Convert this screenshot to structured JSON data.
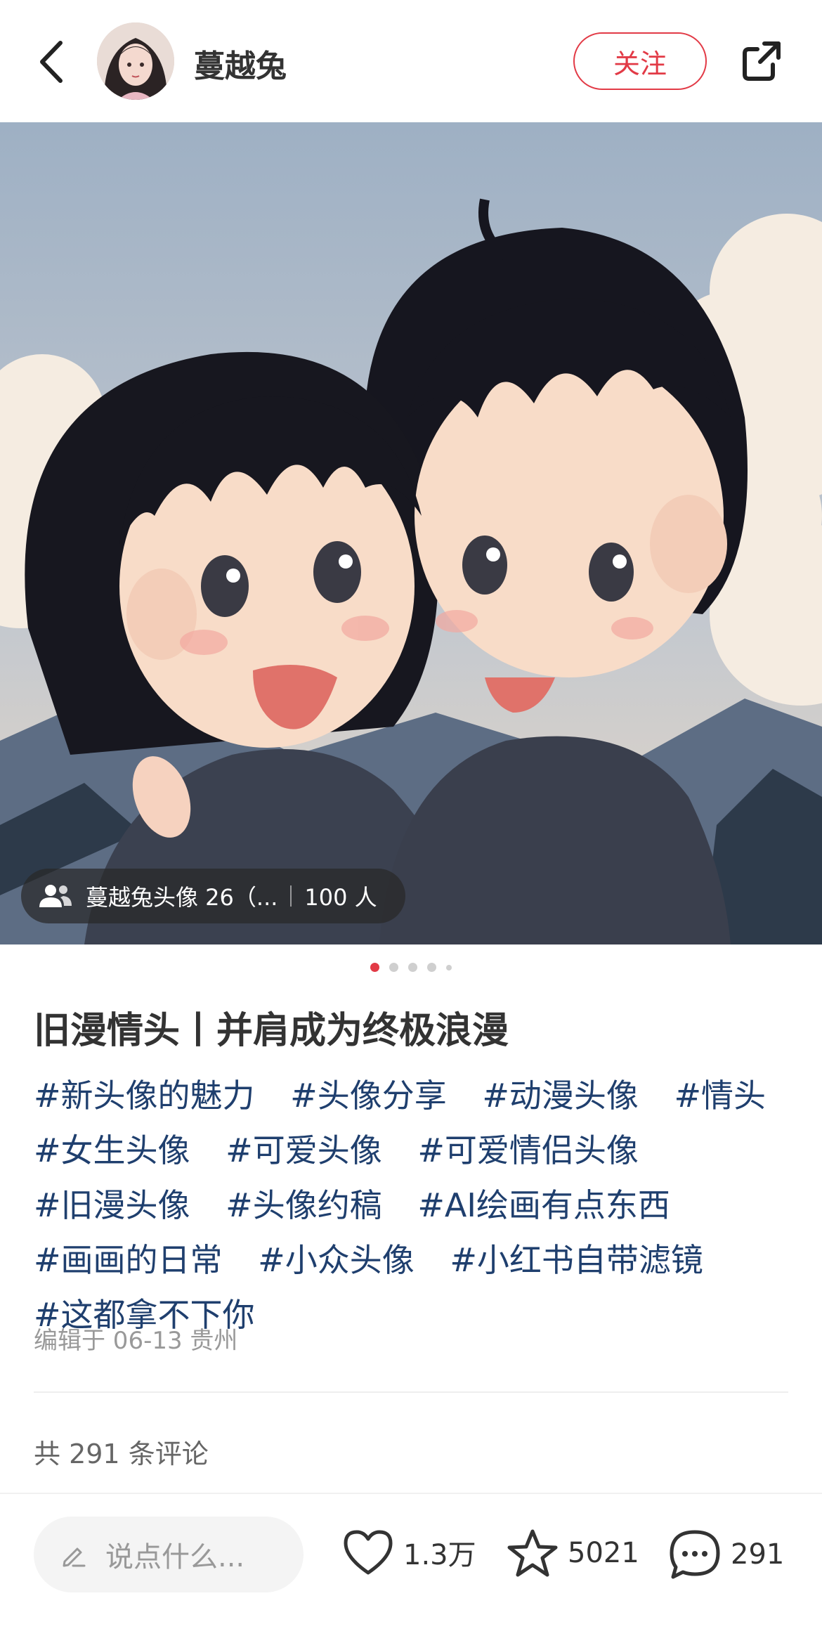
{
  "header": {
    "author_name": "蔓越兔",
    "follow_label": "关注",
    "icons": [
      "back-icon",
      "share-icon"
    ]
  },
  "post": {
    "group_chip": {
      "name": "蔓越兔头像 26（...",
      "members": "100 人",
      "icon": "group-icon"
    },
    "carousel": {
      "total": 5,
      "active": 1
    },
    "title": "旧漫情头丨并肩成为终极浪漫",
    "tags": [
      "#新头像的魅力",
      "#头像分享",
      "#动漫头像",
      "#情头",
      "#女生头像",
      "#可爱头像",
      "#可爱情侣头像",
      "#旧漫头像",
      "#头像约稿",
      "#AI绘画有点东西",
      "#画画的日常",
      "#小众头像",
      "#小红书自带滤镜",
      "#这都拿不下你"
    ],
    "edit_info": "编辑于 06-13 贵州",
    "comment_count_text": "共 291 条评论"
  },
  "bottom_bar": {
    "input_placeholder": "说点什么...",
    "likes": "1.3万",
    "collects": "5021",
    "comments": "291"
  },
  "colors": {
    "accent": "#e23a46",
    "tag": "#1f3f6e"
  }
}
